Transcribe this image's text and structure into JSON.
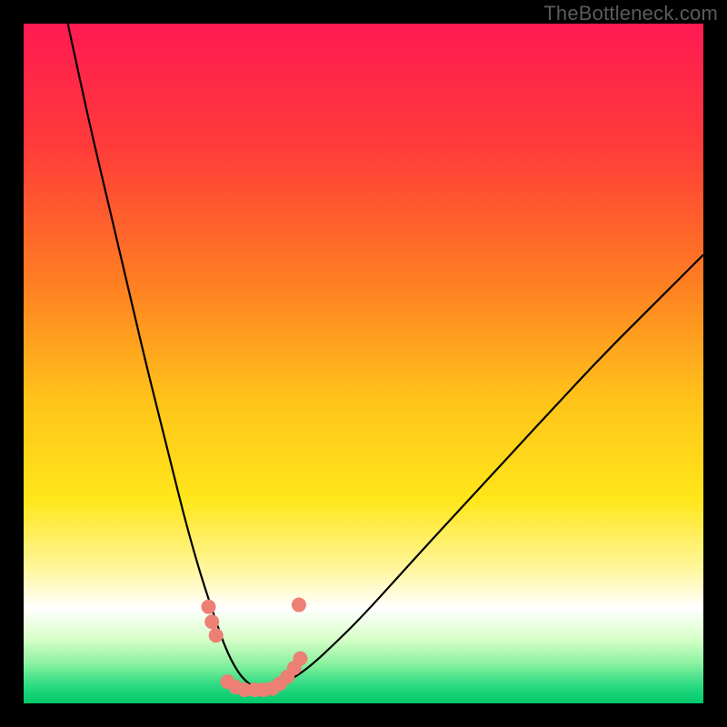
{
  "watermark": "TheBottleneck.com",
  "chart_data": {
    "type": "line",
    "title": "",
    "xlabel": "",
    "ylabel": "",
    "xlim": [
      0,
      100
    ],
    "ylim": [
      0,
      100
    ],
    "gradient_stops": [
      {
        "t": 0.0,
        "color": "#ff1a52"
      },
      {
        "t": 0.18,
        "color": "#ff3b3a"
      },
      {
        "t": 0.38,
        "color": "#ff7e22"
      },
      {
        "t": 0.55,
        "color": "#ffc21a"
      },
      {
        "t": 0.7,
        "color": "#ffe61a"
      },
      {
        "t": 0.8,
        "color": "#fff69a"
      },
      {
        "t": 0.86,
        "color": "#ffffff"
      },
      {
        "t": 0.905,
        "color": "#d8ffc9"
      },
      {
        "t": 0.94,
        "color": "#8ef2a1"
      },
      {
        "t": 0.975,
        "color": "#28d980"
      },
      {
        "t": 1.0,
        "color": "#00c86a"
      }
    ],
    "series": [
      {
        "name": "bottleneck-curve",
        "x": [
          6.5,
          8,
          10,
          12,
          14,
          16,
          18,
          20,
          22,
          23.5,
          25,
          26.5,
          28,
          29,
          30,
          31,
          32,
          33,
          34,
          35.5,
          37,
          39,
          42,
          46,
          50,
          55,
          60,
          66,
          72,
          78,
          85,
          92,
          100
        ],
        "values": [
          100,
          93,
          84,
          75.5,
          67,
          58.5,
          50,
          42,
          34,
          28,
          22.5,
          17.5,
          13,
          10,
          7.5,
          5.5,
          4,
          3,
          2.3,
          2,
          2.3,
          3.3,
          5.3,
          9,
          13,
          18.5,
          24,
          30.5,
          37,
          43.5,
          51,
          58,
          66
        ],
        "color": "#000000",
        "width": 2.2
      }
    ],
    "markers": {
      "name": "highlight-points",
      "color": "#ec8074",
      "radius": 8,
      "points": [
        {
          "x": 27.2,
          "y": 14.2
        },
        {
          "x": 27.7,
          "y": 12.0
        },
        {
          "x": 28.3,
          "y": 10.0
        },
        {
          "x": 30.0,
          "y": 3.2
        },
        {
          "x": 31.2,
          "y": 2.4
        },
        {
          "x": 32.5,
          "y": 2.0
        },
        {
          "x": 34.0,
          "y": 2.0
        },
        {
          "x": 35.3,
          "y": 2.0
        },
        {
          "x": 36.6,
          "y": 2.2
        },
        {
          "x": 37.7,
          "y": 2.9
        },
        {
          "x": 38.8,
          "y": 3.9
        },
        {
          "x": 39.8,
          "y": 5.2
        },
        {
          "x": 40.7,
          "y": 6.6
        },
        {
          "x": 40.5,
          "y": 14.5
        }
      ]
    }
  }
}
